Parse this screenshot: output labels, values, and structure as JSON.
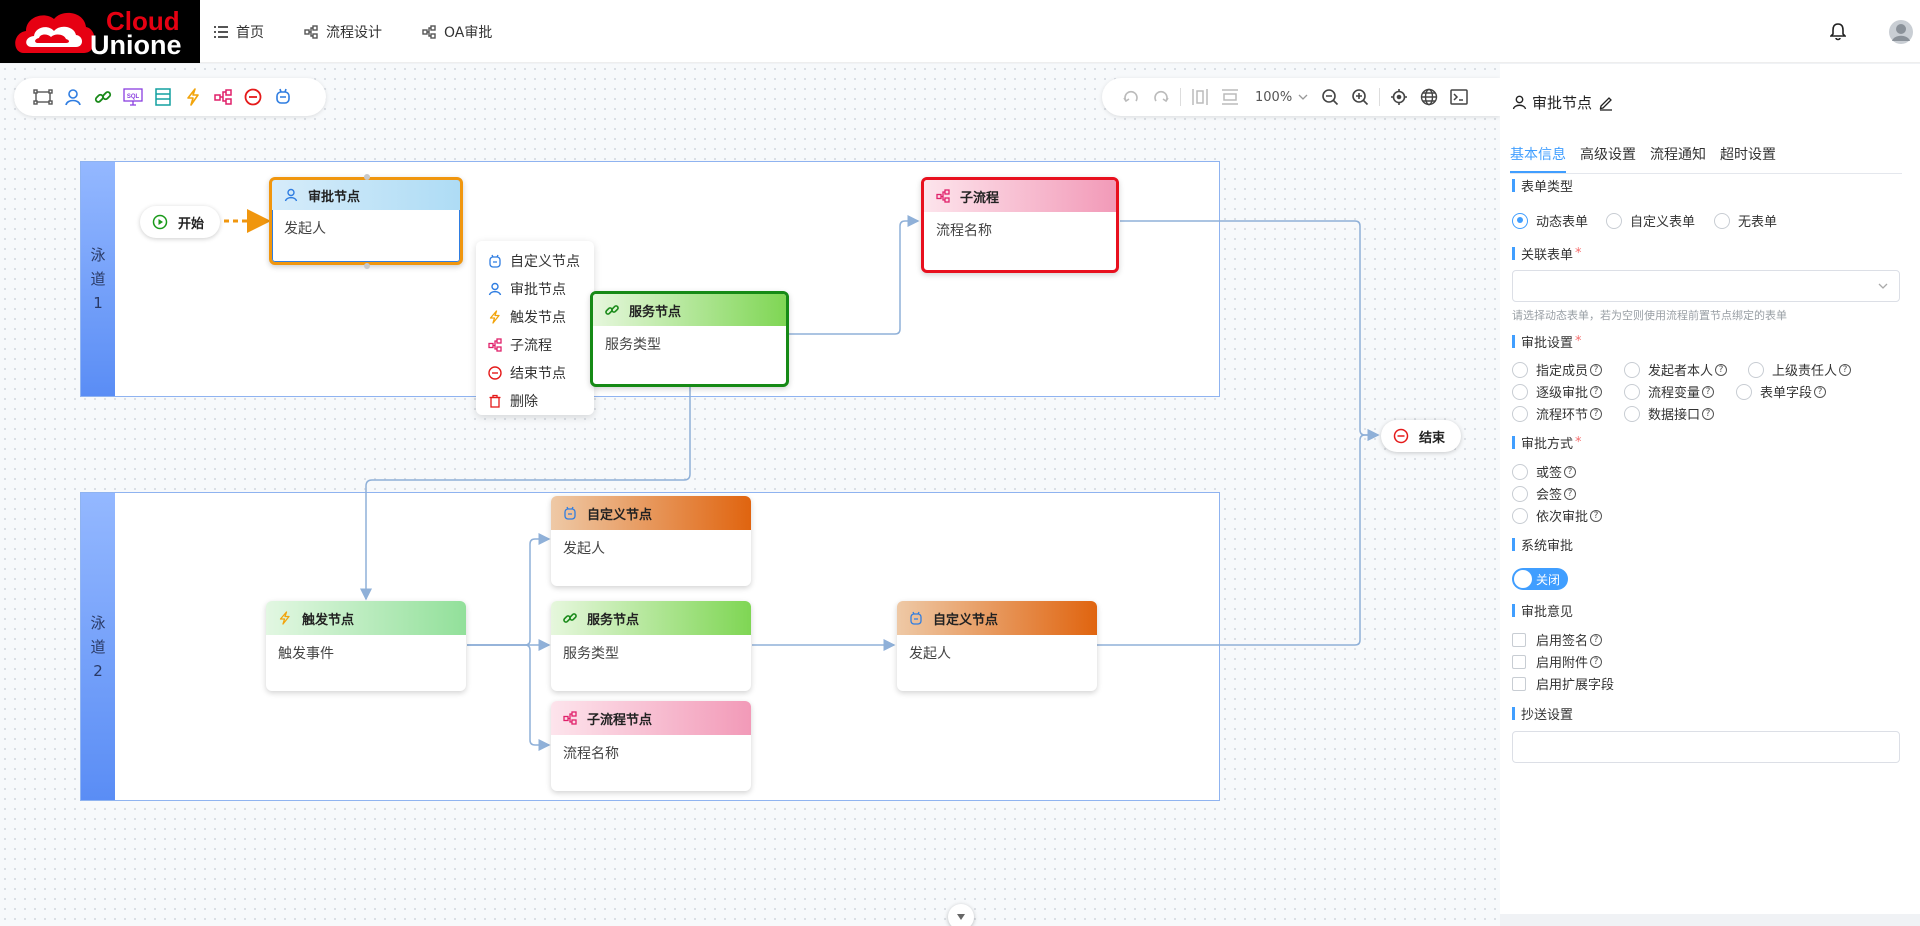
{
  "brand": {
    "line1": "Cloud",
    "line2": "Unione"
  },
  "nav": [
    {
      "label": "首页"
    },
    {
      "label": "流程设计"
    },
    {
      "label": "OA审批"
    }
  ],
  "toolbar": {
    "zoom": "100%"
  },
  "lanes": [
    {
      "label": [
        "泳",
        "道",
        "1"
      ]
    },
    {
      "label": [
        "泳",
        "道",
        "2"
      ]
    }
  ],
  "start": {
    "label": "开始"
  },
  "end": {
    "label": "结束"
  },
  "nodes": {
    "approval": {
      "title": "审批节点",
      "body": "发起人"
    },
    "service1": {
      "title": "服务节点",
      "body": "服务类型"
    },
    "subflow1": {
      "title": "子流程",
      "body": "流程名称"
    },
    "trigger": {
      "title": "触发节点",
      "body": "触发事件"
    },
    "custom1": {
      "title": "自定义节点",
      "body": "发起人"
    },
    "service2": {
      "title": "服务节点",
      "body": "服务类型"
    },
    "subflow2": {
      "title": "子流程节点",
      "body": "流程名称"
    },
    "custom2": {
      "title": "自定义节点",
      "body": "发起人"
    }
  },
  "context_menu": [
    "自定义节点",
    "审批节点",
    "触发节点",
    "子流程",
    "结束节点",
    "删除"
  ],
  "panel": {
    "title": "审批节点",
    "tabs": [
      "基本信息",
      "高级设置",
      "流程通知",
      "超时设置"
    ],
    "form_type": {
      "label": "表单类型",
      "options": [
        "动态表单",
        "自定义表单",
        "无表单"
      ],
      "selected": "动态表单"
    },
    "linked_form": {
      "label": "关联表单",
      "value": "",
      "hint": "请选择动态表单，若为空则使用流程前置节点绑定的表单"
    },
    "approval_settings": {
      "label": "审批设置",
      "options": [
        "指定成员",
        "发起者本人",
        "上级责任人",
        "逐级审批",
        "流程变量",
        "表单字段",
        "流程环节",
        "数据接口"
      ]
    },
    "approval_method": {
      "label": "审批方式",
      "options": [
        "或签",
        "会签",
        "依次审批"
      ]
    },
    "system_approval": {
      "label": "系统审批",
      "switch_text": "关闭"
    },
    "approval_opinion": {
      "label": "审批意见",
      "options": [
        "启用签名",
        "启用附件",
        "启用扩展字段"
      ]
    },
    "cc_settings": {
      "label": "抄送设置",
      "value": ""
    }
  },
  "colors": {
    "accent": "#409eff",
    "lane_border": "#8fb3f0",
    "selected_orange": "#f0960e",
    "selected_red": "#e8101e",
    "selected_green": "#168a16"
  }
}
